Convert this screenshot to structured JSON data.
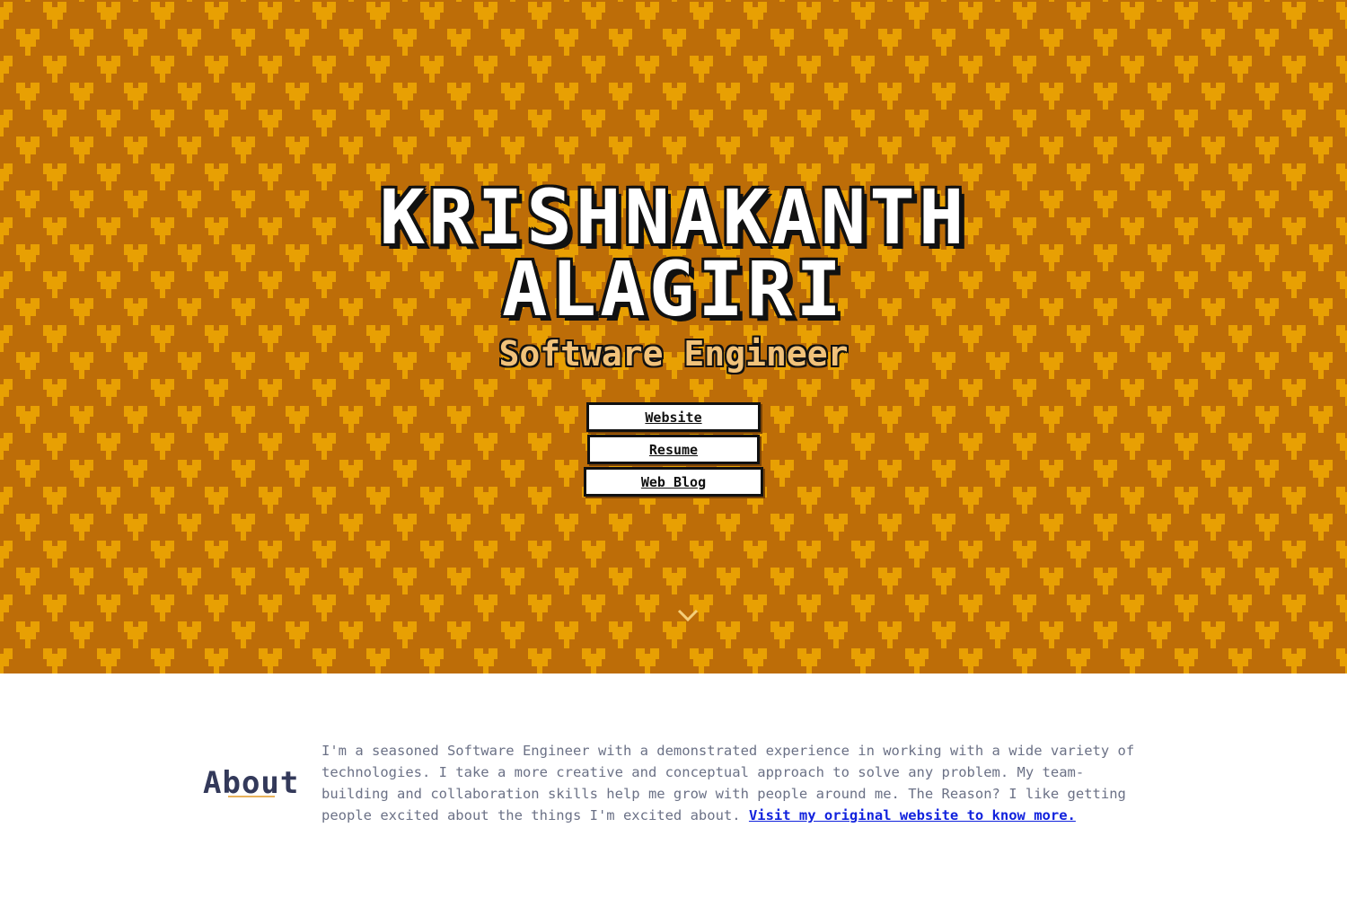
{
  "colors": {
    "hero_background": "#bd6d08",
    "pattern_shape": "#e8a003",
    "title_fill": "#ffffff",
    "title_outline": "#111111",
    "role_fill": "#f1c27a",
    "about_heading": "#33395a",
    "about_underline": "#e8b25c",
    "body_text": "#6b7186",
    "link": "#1122dd"
  },
  "hero": {
    "name_line_1": "KRISHNAKANTH",
    "name_line_2": "ALAGIRI",
    "role": "Software Engineer",
    "buttons": {
      "website": "Website",
      "resume": "Resume",
      "blog": "Web Blog"
    },
    "scroll_icon": "chevron-down-icon",
    "pattern_icon": "pixel-heart-pattern"
  },
  "about": {
    "title": "About",
    "text": "I'm a seasoned Software Engineer with a demonstrated experience in working with a wide variety of technologies. I take a more creative and conceptual approach to solve any problem. My team-building and collaboration skills help me grow with people around me. The Reason? I like getting people excited about the things I'm excited about.",
    "link_text": "Visit my original website to know more."
  }
}
